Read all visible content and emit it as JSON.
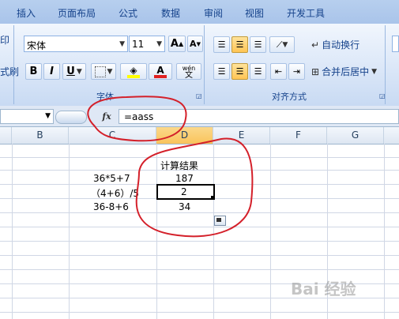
{
  "tabs": [
    "插入",
    "页面布局",
    "公式",
    "数据",
    "审阅",
    "视图",
    "开发工具"
  ],
  "font_group": {
    "font_name": "宋体",
    "font_size": "11",
    "grow_label": "A",
    "shrink_label": "A",
    "bold": "B",
    "italic": "I",
    "underline": "U",
    "font_color_letter": "A",
    "phonetic": "wén",
    "label": "字体"
  },
  "left_clip": {
    "top": "印",
    "bottom": "式刷"
  },
  "align_group": {
    "wrap_text": "自动换行",
    "merge_center": "合并后居中",
    "label": "对齐方式"
  },
  "formula_bar": {
    "name_box": "",
    "fx": "fx",
    "formula": "=aass"
  },
  "columns": [
    "B",
    "C",
    "D",
    "E",
    "F",
    "G"
  ],
  "selected_column": "D",
  "cells": {
    "header": "计算结果",
    "r1_expr": "36*5+7",
    "r1_val": "187",
    "r2_expr": "（4+6）/5",
    "r2_val": "2",
    "r3_expr": "36-8+6",
    "r3_val": "34"
  },
  "colors": {
    "annotation": "#d4202a",
    "font_color_bar": "#e02020",
    "fill_color_bar": "#ffff00",
    "selection_border": "#000000"
  }
}
